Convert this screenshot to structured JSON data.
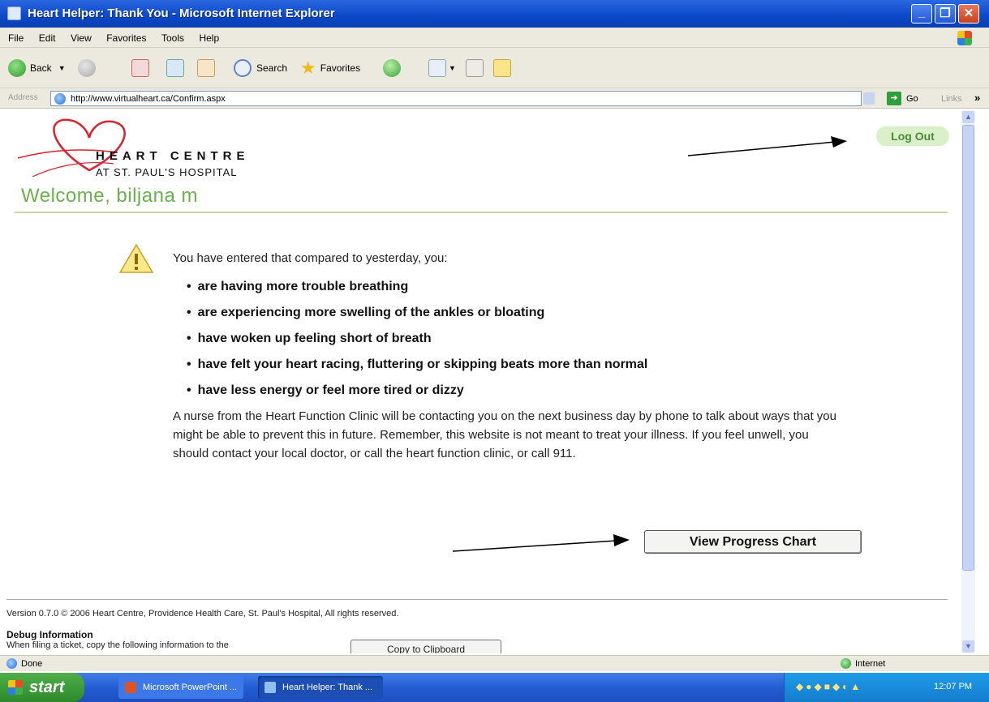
{
  "window": {
    "title": "Heart Helper: Thank You - Microsoft Internet Explorer"
  },
  "menu": [
    "File",
    "Edit",
    "View",
    "Favorites",
    "Tools",
    "Help"
  ],
  "toolbar": {
    "back": "Back",
    "search": "Search",
    "favorites": "Favorites"
  },
  "address": {
    "label": "Address",
    "url": "http://www.virtualheart.ca/Confirm.aspx",
    "go": "Go",
    "links": "Links",
    "more": "»"
  },
  "header": {
    "logo_name": "HEART CENTRE",
    "logo_sub": "AT ST. PAUL'S HOSPITAL",
    "welcome": "Welcome, biljana m",
    "logout": "Log Out"
  },
  "main": {
    "intro": "You have entered that compared to yesterday, you:",
    "symptoms": [
      "are having more trouble breathing",
      "are experiencing more swelling of the ankles or bloating",
      "have woken up feeling short of breath",
      "have felt your heart racing, fluttering or skipping beats more than normal",
      "have less energy or feel more tired or dizzy"
    ],
    "paragraph": "A nurse from the Heart Function Clinic will be contacting you on the next business day by phone to talk about ways that you might be able to prevent this in future. Remember, this website is not meant to treat your illness. If you feel unwell, you should contact your local doctor, or call the heart function clinic, or call 911.",
    "progress_button": "View Progress Chart"
  },
  "footer": {
    "version": "Version 0.7.0 © 2006 Heart Centre, Providence Health Care, St. Paul's Hospital, All rights reserved.",
    "debug_title": "Debug Information",
    "debug_text": "When filing a ticket, copy the following information to the",
    "copy_button": "Copy to Clipboard"
  },
  "status": {
    "left": "Done",
    "zone": "Internet"
  },
  "taskbar": {
    "start": "start",
    "tasks": [
      "Microsoft PowerPoint ...",
      "Heart Helper: Thank ..."
    ],
    "clock": "12:07 PM"
  },
  "colors": {
    "accent_green": "#6ab04c",
    "logo_red": "#d9232e",
    "titlebar_blue": "#0b48c8"
  }
}
